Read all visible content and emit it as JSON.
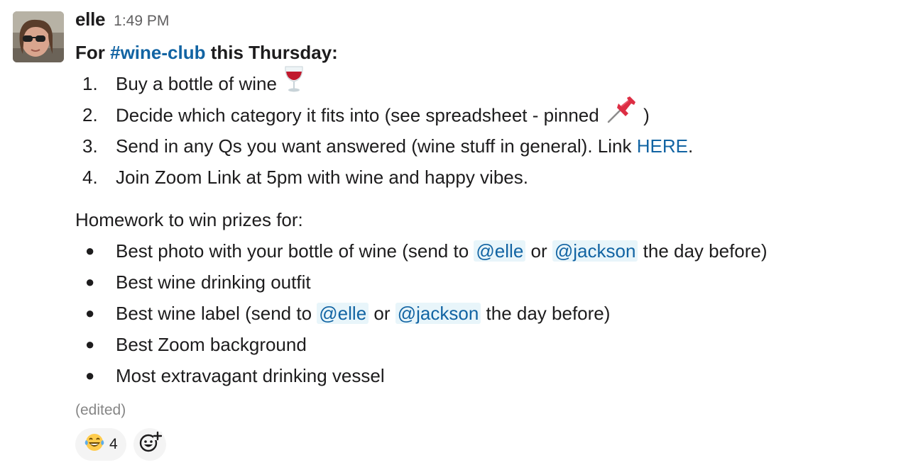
{
  "message": {
    "author": "elle",
    "time": "1:49 PM",
    "headline": {
      "prefix": "For ",
      "channel": "#wine-club",
      "suffix": " this Thursday:"
    },
    "steps": [
      {
        "marker": "1.",
        "text": "Buy a bottle of wine",
        "emoji": "wine-glass-icon"
      },
      {
        "marker": "2.",
        "text_before": "Decide which category it fits into (see spreadsheet - pinned",
        "emoji": "pushpin-icon",
        "text_after": ")"
      },
      {
        "marker": "3.",
        "text_before": "Send in any Qs you want answered (wine stuff in general). Link ",
        "link": "HERE",
        "text_after": "."
      },
      {
        "marker": "4.",
        "text": "Join Zoom Link at 5pm with wine and happy vibes."
      }
    ],
    "homework_title": "Homework to win prizes for:",
    "homework": [
      {
        "marker": "●",
        "before": "Best photo with your bottle of wine (send to ",
        "mention1": "@elle",
        "middle": " or ",
        "mention2": "@jackson",
        "after": " the day before)"
      },
      {
        "marker": "●",
        "text": "Best wine drinking outfit"
      },
      {
        "marker": "●",
        "before": "Best wine label (send to ",
        "mention1": "@elle",
        "middle": " or ",
        "mention2": "@jackson",
        "after": " the day before)"
      },
      {
        "marker": "●",
        "text": "Best Zoom background"
      },
      {
        "marker": "●",
        "text": "Most extravagant drinking vessel"
      }
    ],
    "edited_label": "(edited)",
    "reactions": [
      {
        "emoji": "laughing-tears-icon",
        "count": "4"
      }
    ],
    "add_reaction_icon": "add-reaction-icon",
    "colors": {
      "link": "#1264a3",
      "mention_bg": "#e8f5fa",
      "text": "#1d1c1d",
      "muted": "#616061"
    }
  }
}
